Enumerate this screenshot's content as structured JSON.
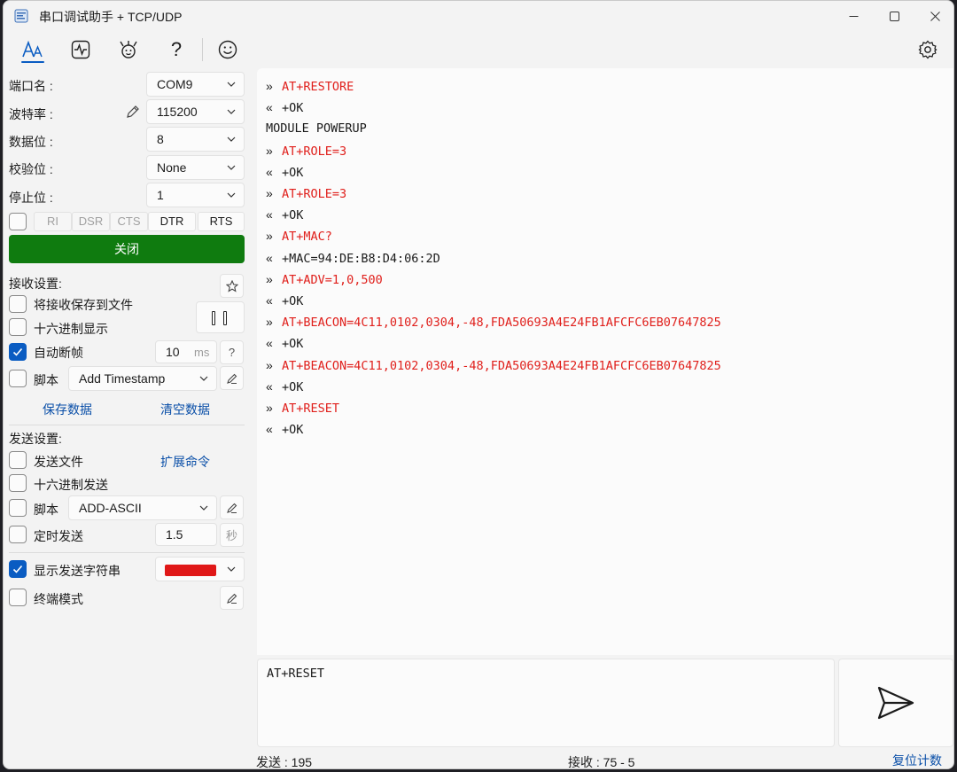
{
  "window": {
    "title": "串口调试助手 + TCP/UDP",
    "minimize_label": "—",
    "maximize_label": "☐",
    "close_label": "✕"
  },
  "toolbar": {
    "icons": [
      "font-icon",
      "waveform-icon",
      "plugin-icon",
      "help-icon",
      "smiley-icon",
      "settings-icon"
    ],
    "help_label": "?"
  },
  "serial": {
    "port_label": "端口名 :",
    "port_value": "COM9",
    "baud_label": "波特率 :",
    "baud_value": "115200",
    "databits_label": "数据位 :",
    "databits_value": "8",
    "parity_label": "校验位 :",
    "parity_value": "None",
    "stopbits_label": "停止位 :",
    "stopbits_value": "1",
    "pins": [
      "RI",
      "DSR",
      "CTS",
      "DTR",
      "RTS"
    ],
    "close_button": "关闭"
  },
  "receive_settings": {
    "title": "接收设置:",
    "save_to_file": "将接收保存到文件",
    "save_to_file_checked": false,
    "hex_display": "十六进制显示",
    "hex_display_checked": false,
    "auto_frame": "自动断帧",
    "auto_frame_checked": true,
    "frame_timeout": "10",
    "frame_unit": "ms",
    "frame_help": "?",
    "script_label": "脚本",
    "script_checked": false,
    "script_value": "Add Timestamp",
    "save_data": "保存数据",
    "clear_data": "清空数据"
  },
  "send_settings": {
    "title": "发送设置:",
    "send_file": "发送文件",
    "send_file_checked": false,
    "ext_commands": "扩展命令",
    "hex_send": "十六进制发送",
    "hex_send_checked": false,
    "script_label": "脚本",
    "script_checked": false,
    "script_value": "ADD-ASCII",
    "timed_send": "定时发送",
    "timed_send_checked": false,
    "timed_interval": "1.5",
    "timed_unit": "秒",
    "show_sent": "显示发送字符串",
    "show_sent_checked": true,
    "show_sent_color": "#e01818",
    "terminal_mode": "终端模式",
    "terminal_mode_checked": false
  },
  "receive_log": [
    {
      "dir": "»",
      "text": "AT+RESTORE",
      "sent": true
    },
    {
      "dir": "«",
      "text": "+OK",
      "sent": false
    },
    {
      "dir": "",
      "text": "MODULE POWERUP",
      "sent": false
    },
    {
      "dir": "»",
      "text": "AT+ROLE=3",
      "sent": true
    },
    {
      "dir": "«",
      "text": "+OK",
      "sent": false
    },
    {
      "dir": "»",
      "text": "AT+ROLE=3",
      "sent": true
    },
    {
      "dir": "«",
      "text": "+OK",
      "sent": false
    },
    {
      "dir": "»",
      "text": "AT+MAC?",
      "sent": true
    },
    {
      "dir": "«",
      "text": "+MAC=94:DE:B8:D4:06:2D",
      "sent": false
    },
    {
      "dir": "»",
      "text": "AT+ADV=1,0,500",
      "sent": true
    },
    {
      "dir": "«",
      "text": "+OK",
      "sent": false
    },
    {
      "dir": "»",
      "text": "AT+BEACON=4C11,0102,0304,-48,FDA50693A4E24FB1AFCFC6EB07647825",
      "sent": true
    },
    {
      "dir": "«",
      "text": "+OK",
      "sent": false
    },
    {
      "dir": "»",
      "text": "AT+BEACON=4C11,0102,0304,-48,FDA50693A4E24FB1AFCFC6EB07647825",
      "sent": true
    },
    {
      "dir": "«",
      "text": "+OK",
      "sent": false
    },
    {
      "dir": "»",
      "text": "AT+RESET",
      "sent": true
    },
    {
      "dir": "«",
      "text": "+OK",
      "sent": false
    }
  ],
  "send_input": {
    "value": "AT+RESET"
  },
  "status": {
    "sent": "发送 : 195",
    "received": "接收 : 75  -  5",
    "reset_count": "复位计数"
  }
}
